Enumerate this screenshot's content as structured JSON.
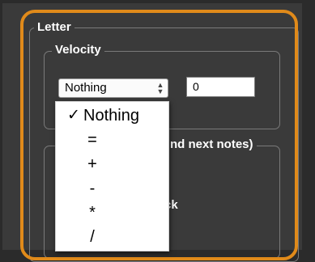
{
  "letter_group": {
    "title": "Letter"
  },
  "velocity_group": {
    "title": "Velocity"
  },
  "velocity_mode_select": {
    "value": "Nothing"
  },
  "velocity_value_input": {
    "value": "0"
  },
  "partially_hidden_text": {
    "group_title_fragment": "nd next notes)",
    "line1_fragment": "]",
    "line2_fragment": "ck"
  },
  "dropdown": {
    "options": [
      {
        "label": "Nothing",
        "selected": true,
        "check_glyph": "✓"
      },
      {
        "label": "=",
        "selected": false
      },
      {
        "label": "+",
        "selected": false
      },
      {
        "label": "-",
        "selected": false
      },
      {
        "label": "*",
        "selected": false
      },
      {
        "label": "/",
        "selected": false
      }
    ]
  },
  "colors": {
    "accent_ring": "#e08a1a",
    "panel_bg": "#3a3a3a"
  }
}
